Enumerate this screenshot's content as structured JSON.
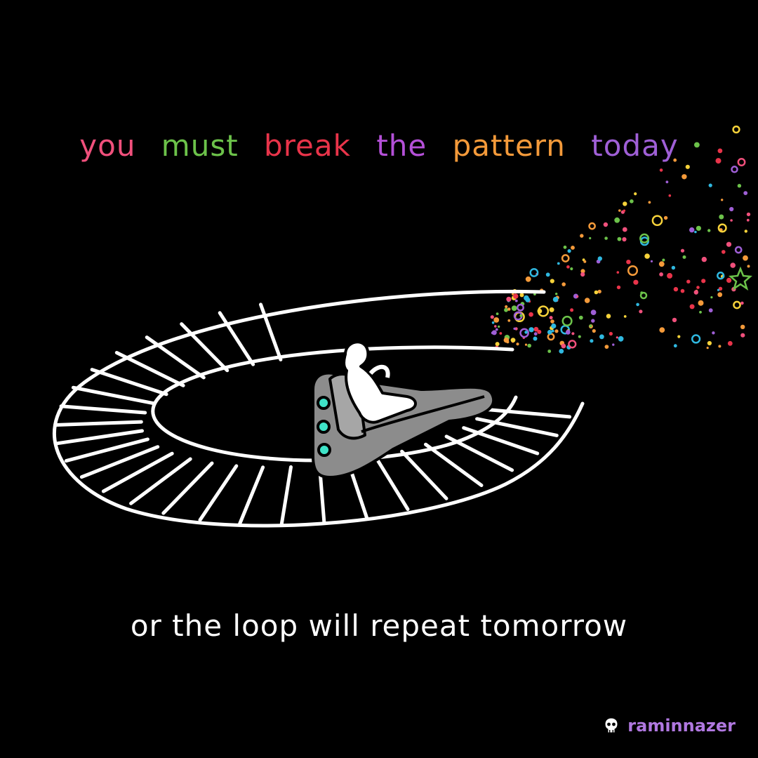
{
  "headline": {
    "words": [
      {
        "text": "you",
        "color": "#f0507c"
      },
      {
        "text": "must",
        "color": "#6cc24a"
      },
      {
        "text": "break",
        "color": "#e9344a"
      },
      {
        "text": "the",
        "color": "#b450d8"
      },
      {
        "text": "pattern",
        "color": "#f49a3a"
      },
      {
        "text": "today",
        "color": "#9f5fd6"
      }
    ]
  },
  "caption": "or the loop will repeat tomorrow",
  "signature": {
    "handle": "raminnazer",
    "color": "#b078e0",
    "icon": "skull-icon"
  },
  "palette": {
    "background": "#000000",
    "line": "#ffffff",
    "cart": "#8c8c8c",
    "cart_lights": "#3fe3c8",
    "confetti": [
      "#e9344a",
      "#f49a3a",
      "#f6d23a",
      "#6cc24a",
      "#2fb8e0",
      "#9f5fd6",
      "#f0507c"
    ]
  }
}
